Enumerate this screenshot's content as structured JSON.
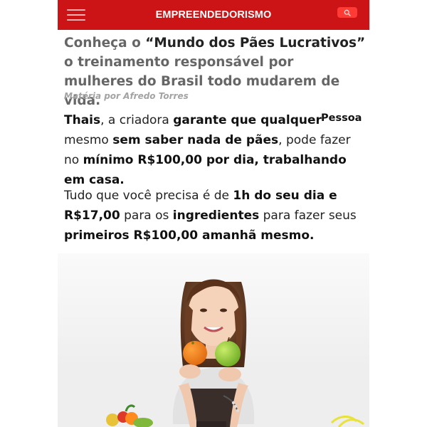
{
  "header": {
    "brand": "EMPREENDEDORISMO",
    "menu_icon": "hamburger-menu-icon",
    "search_icon": "search-icon",
    "bar_color": "#cc1417",
    "search_button_color": "#ff3b36"
  },
  "article": {
    "headline_start": "Conheça o ",
    "headline_quote": "“Mundo dos Pães Lucrativos”",
    "headline_end": " o treinamento responsável por mulheres do Brasil todo mudarem de vida.",
    "byline": "Matéria por Afredo Torres",
    "para1": {
      "name": "Thais",
      "t1": ", a criadora ",
      "b1": "garante que qualquer",
      "floating": "Pessoa",
      "t2": "mesmo ",
      "b2": "sem saber nada de pães",
      "t3": ", pode fazer no ",
      "b3": "mínimo R$100,00 por dia, trabalhando em casa."
    },
    "para2": {
      "t1": "Tudo que você precisa é de ",
      "b1": "1h do seu dia e R$17,00",
      "t2": " para os ",
      "b2": "ingredientes",
      "t3": " para fazer seus ",
      "b3": "primeiros R$100,00 amanhã mesmo."
    }
  }
}
